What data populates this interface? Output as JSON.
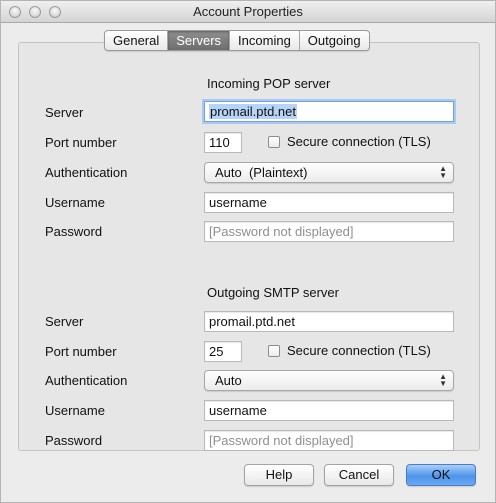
{
  "window": {
    "title": "Account Properties"
  },
  "tabs": [
    {
      "label": "General"
    },
    {
      "label": "Servers"
    },
    {
      "label": "Incoming"
    },
    {
      "label": "Outgoing"
    }
  ],
  "active_tab": "Servers",
  "incoming": {
    "section_title": "Incoming POP server",
    "server_label": "Server",
    "server_value": "promail.ptd.net",
    "port_label": "Port number",
    "port_value": "110",
    "secure_label": "Secure connection (TLS)",
    "secure_checked": false,
    "auth_label": "Authentication",
    "auth_value": "Auto  (Plaintext)",
    "username_label": "Username",
    "username_value": "username",
    "password_label": "Password",
    "password_placeholder": "[Password not displayed]"
  },
  "outgoing": {
    "section_title": "Outgoing SMTP server",
    "server_label": "Server",
    "server_value": "promail.ptd.net",
    "port_label": "Port number",
    "port_value": "25",
    "secure_label": "Secure connection (TLS)",
    "secure_checked": false,
    "auth_label": "Authentication",
    "auth_value": "Auto",
    "username_label": "Username",
    "username_value": "username",
    "password_label": "Password",
    "password_placeholder": "[Password not displayed]"
  },
  "buttons": {
    "help": "Help",
    "cancel": "Cancel",
    "ok": "OK"
  },
  "icons": {
    "popup_arrows": "up-down-chevron-icon"
  },
  "colors": {
    "focus_ring": "#a9c9f1",
    "selection": "#b6d4f7",
    "default_button": "#4f94ea"
  }
}
